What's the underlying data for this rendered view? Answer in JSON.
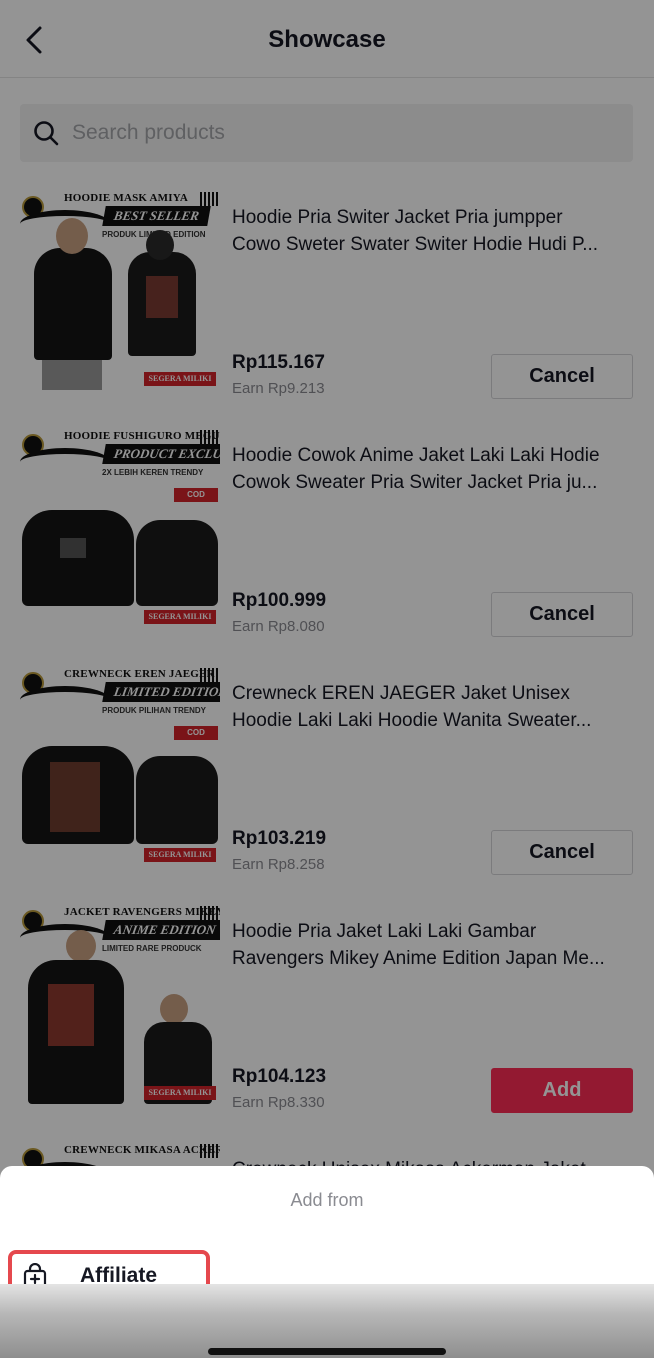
{
  "header": {
    "title": "Showcase"
  },
  "search": {
    "placeholder": "Search products"
  },
  "products": [
    {
      "title_line1": "Hoodie Pria Switer Jacket Pria jumpper",
      "title_line2": "Cowo Sweter Swater Switer Hodie Hudi P...",
      "price": "Rp115.167",
      "earn": "Earn Rp9.213",
      "action": "Cancel",
      "image": {
        "banner": "HOODIE MASK AMIYA",
        "tag": "BEST SELLER",
        "sub": "PRODUK LIMITED EDITION",
        "footer": "SEGERA MILIKI"
      }
    },
    {
      "title_line1": "Hoodie Cowok Anime Jaket Laki Laki Hodie",
      "title_line2": "Cowok Sweater Pria Switer Jacket Pria ju...",
      "price": "Rp100.999",
      "earn": "Earn Rp8.080",
      "action": "Cancel",
      "image": {
        "banner": "HOODIE FUSHIGURO MEGUMI",
        "tag": "PRODUCT EXCLUSIVE",
        "sub": "2X LEBIH KEREN TRENDY",
        "cod": "COD",
        "footer": "SEGERA MILIKI"
      }
    },
    {
      "title_line1": "Crewneck EREN JAEGER Jaket Unisex",
      "title_line2": "Hoodie Laki Laki Hoodie Wanita Sweater...",
      "price": "Rp103.219",
      "earn": "Earn Rp8.258",
      "action": "Cancel",
      "image": {
        "banner": "CREWNECK EREN JAEGER",
        "tag": "LIMITED EDITION",
        "sub": "PRODUK PILIHAN TRENDY",
        "cod": "COD",
        "footer": "SEGERA MILIKI"
      }
    },
    {
      "title_line1": "Hoodie Pria Jaket Laki Laki Gambar",
      "title_line2": "Ravengers Mikey Anime Edition Japan Me...",
      "price": "Rp104.123",
      "earn": "Earn Rp8.330",
      "action": "Add",
      "image": {
        "banner": "JACKET RAVENGERS MIKEY",
        "tag": "ANIME EDITION",
        "sub": "LIMITED RARE PRODUCK",
        "footer": "SEGERA MILIKI"
      }
    },
    {
      "title_line1": "Crewneck Unisex Mikasa Ackerman Jaket",
      "image": {
        "banner": "CREWNECK MIKASA ACKERMAN"
      }
    }
  ],
  "sheet": {
    "title": "Add from",
    "option_label": "Affiliate",
    "option_icon": "shopping-bag-plus-icon"
  }
}
